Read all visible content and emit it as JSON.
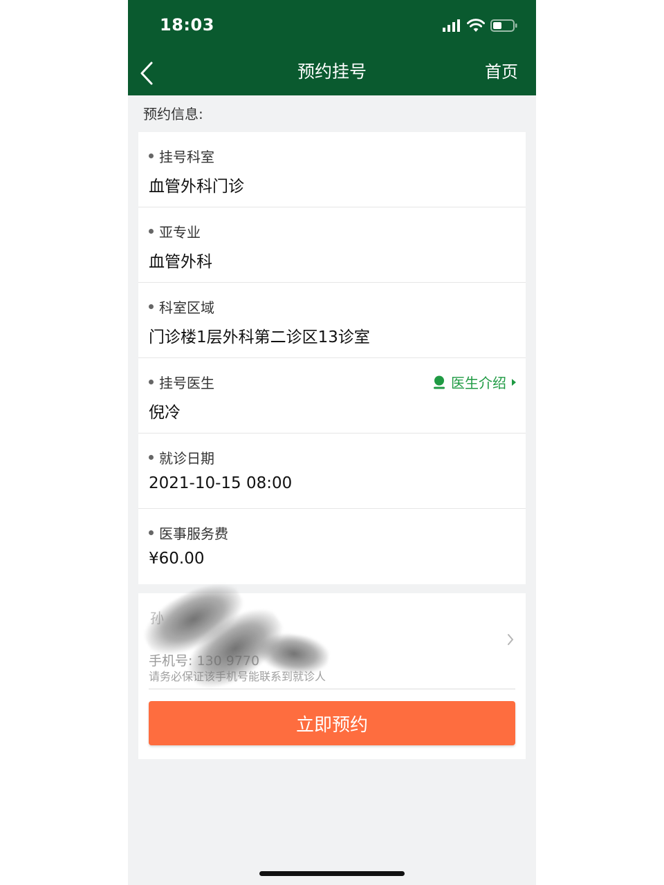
{
  "status_bar": {
    "time": "18:03",
    "icons": [
      "signal-icon",
      "wifi-icon",
      "battery-icon"
    ]
  },
  "nav": {
    "back_icon": "chevron-left-icon",
    "title": "预约挂号",
    "home_label": "首页"
  },
  "section_label": "预约信息:",
  "info_rows": [
    {
      "label": "挂号科室",
      "value": "血管外科门诊"
    },
    {
      "label": "亚专业",
      "value": "血管外科"
    },
    {
      "label": "科室区域",
      "value": "门诊楼1层外科第二诊区13诊室"
    },
    {
      "label": "挂号医生",
      "value": "倪冷"
    },
    {
      "label": "就诊日期",
      "value": "2021-10-15 08:00"
    },
    {
      "label": "医事服务费",
      "value": "¥60.00"
    }
  ],
  "doctor_intro": {
    "label": "医生介绍",
    "icon": "person-icon"
  },
  "patient": {
    "name": "孙",
    "phone": "手机号: 130 9770",
    "hint": "请务必保证该手机号能联系到就诊人"
  },
  "book_button": {
    "label": "立即预约"
  },
  "colors": {
    "header_bg": "#0a5a2f",
    "accent_green": "#1f9a43",
    "button_orange": "#fe6d3f",
    "page_bg": "#f1f2f3"
  }
}
